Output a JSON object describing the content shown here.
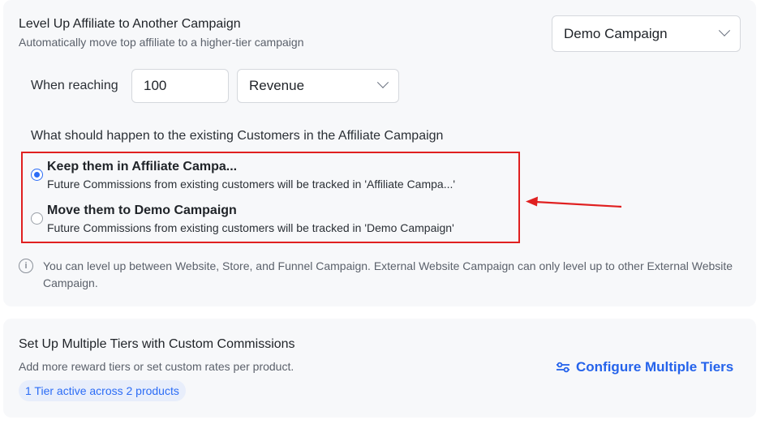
{
  "level_up": {
    "title": "Level Up Affiliate to Another Campaign",
    "subtitle": "Automatically move top affiliate to a higher-tier campaign",
    "campaign_select": "Demo Campaign",
    "when_reaching_label": "When reaching",
    "threshold_value": "100",
    "metric_select": "Revenue",
    "question": "What should happen to the existing Customers in the Affiliate Campaign",
    "options": [
      {
        "title": "Keep them in Affiliate Campa...",
        "description": "Future Commissions from existing customers will be tracked in 'Affiliate Campa...'",
        "selected": true
      },
      {
        "title": "Move them to Demo Campaign",
        "description": "Future Commissions from existing customers will be tracked in 'Demo Campaign'",
        "selected": false
      }
    ],
    "info": "You can level up between Website, Store, and Funnel Campaign. External Website Campaign can only level up to other External Website Campaign."
  },
  "tiers": {
    "title": "Set Up Multiple Tiers with Custom Commissions",
    "subtitle": "Add more reward tiers or set custom rates per product.",
    "badge": "1 Tier active across 2 products",
    "configure_link": "Configure Multiple Tiers"
  },
  "colors": {
    "accent": "#2b6cf6",
    "highlight": "#e02020"
  }
}
